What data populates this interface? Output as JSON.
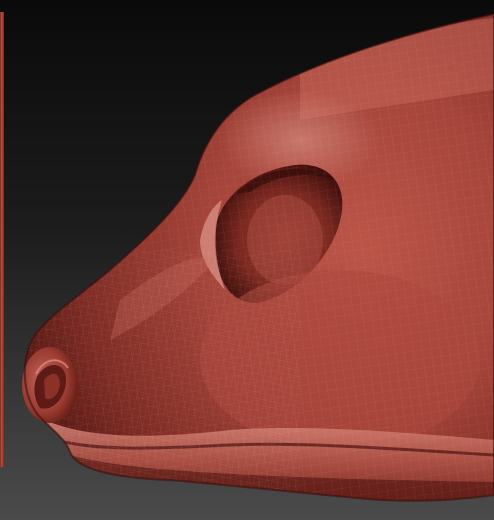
{
  "viewport": {
    "background_top": "#0b0b0b",
    "background_bottom": "#4a4a4a",
    "model_color": "#a9443a",
    "model_highlight": "#d98a7e",
    "model_shadow": "#4c1410"
  },
  "model": {
    "subject": "sculpted-muzzle",
    "material": "red-wax-matcap",
    "wireframe": true
  }
}
